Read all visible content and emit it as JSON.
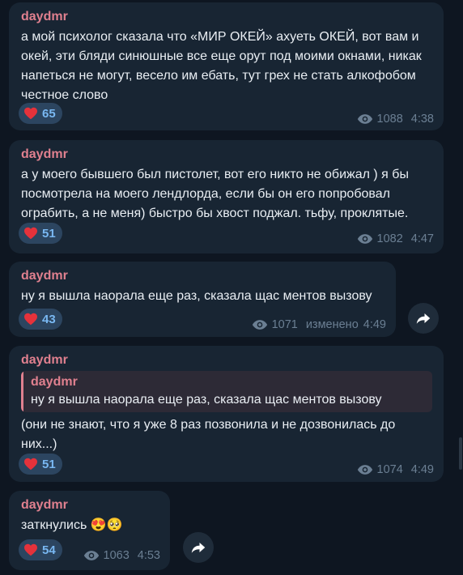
{
  "messages": [
    {
      "author": "daydmr",
      "text": "а мой психолог сказала что «МИР ОКЕЙ» ахуеть ОКЕЙ, вот вам и окей, эти бляди синюшные все еще орут под моими окнами, никак напеться не могут, весело им ебать, тут грех не стать алкофобом честное слово",
      "reaction_count": "65",
      "views": "1088",
      "time": "4:38"
    },
    {
      "author": "daydmr",
      "text": "а у моего бывшего был пистолет, вот его никто не обижал ) я бы посмотрела на моего лендлорда, если бы он его попробовал ограбить, а не меня) быстро бы хвост поджал. тьфу, проклятые.",
      "reaction_count": "51",
      "views": "1082",
      "time": "4:47"
    },
    {
      "author": "daydmr",
      "text": "ну я вышла наорала еще раз, сказала щас ментов вызову",
      "reaction_count": "43",
      "views": "1071",
      "edited": "изменено",
      "time": "4:49"
    },
    {
      "author": "daydmr",
      "quote_author": "daydmr",
      "quote_text": "ну я вышла наорала еще раз, сказала щас ментов вызову",
      "text": "(они не знают, что я уже 8 раз позвонила и не дозвонилась до них...)",
      "reaction_count": "51",
      "views": "1074",
      "time": "4:49"
    },
    {
      "author": "daydmr",
      "text": "заткнулись 😍🥺",
      "reaction_count": "54",
      "views": "1063",
      "time": "4:53"
    }
  ],
  "icons": {
    "reaction": "heart-icon",
    "views": "eye-icon",
    "share": "share-arrow-icon"
  },
  "colors": {
    "background": "#0e1621",
    "bubble": "#182533",
    "author": "#e0808f",
    "reaction_bg": "#2c4560",
    "reaction_text": "#79b8f2",
    "heart": "#e5323b",
    "meta": "#6b7f93"
  }
}
